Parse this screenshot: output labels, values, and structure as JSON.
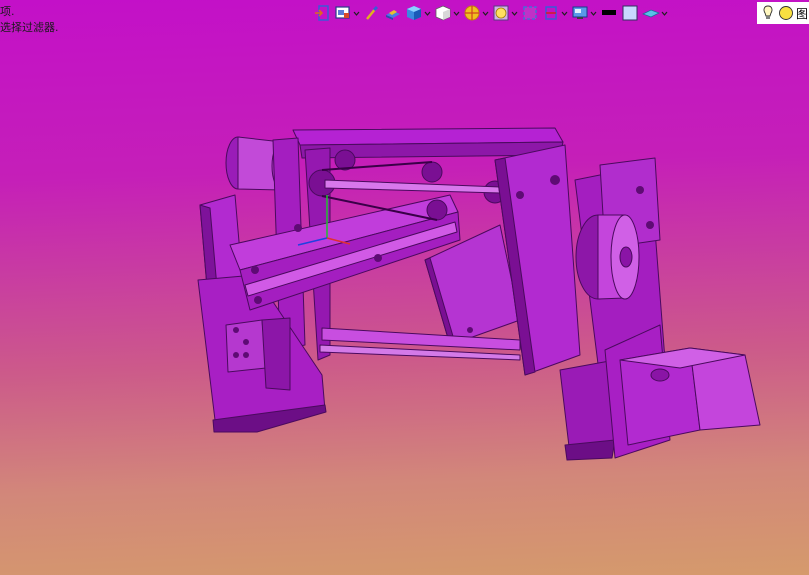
{
  "status": {
    "line1": "项.",
    "line2": "选择过滤器."
  },
  "heads_up_toolbar": {
    "items": [
      {
        "name": "zoom-to-fit-icon",
        "has_dropdown": false
      },
      {
        "name": "zoom-to-area-icon",
        "has_dropdown": true
      },
      {
        "name": "previous-view-icon",
        "has_dropdown": false
      },
      {
        "name": "section-view-icon",
        "has_dropdown": false
      },
      {
        "name": "view-orientation-icon",
        "has_dropdown": true
      },
      {
        "name": "display-style-icon",
        "has_dropdown": true
      },
      {
        "name": "hide-show-items-icon",
        "has_dropdown": true
      },
      {
        "name": "edit-appearance-icon",
        "has_dropdown": true
      },
      {
        "name": "apply-scene-icon",
        "has_dropdown": false
      },
      {
        "name": "view-settings-icon",
        "has_dropdown": true
      },
      {
        "name": "monitor-icon",
        "has_dropdown": true
      },
      {
        "name": "black-swatch-icon",
        "has_dropdown": false
      },
      {
        "name": "lavender-swatch-icon",
        "has_dropdown": false
      },
      {
        "name": "plane-swatch-icon",
        "has_dropdown": true
      }
    ],
    "right_panel_partial_text": "图"
  },
  "colors": {
    "background_top": "#c310c8",
    "background_bottom": "#d59a6c",
    "model_fill": "#b31cd0",
    "model_dark": "#7a0f93",
    "model_light": "#d25ae6"
  }
}
